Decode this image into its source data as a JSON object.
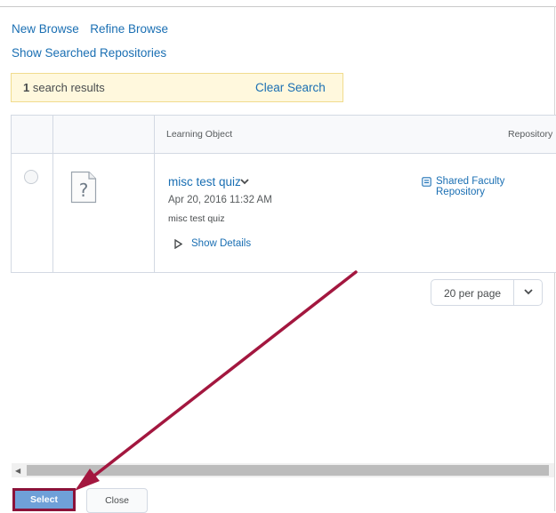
{
  "nav": {
    "new_browse": "New Browse",
    "refine_browse": "Refine Browse",
    "show_searched": "Show Searched Repositories"
  },
  "results": {
    "count": "1",
    "label": " search results",
    "clear_label": "Clear Search"
  },
  "table": {
    "headers": {
      "learning_object": "Learning Object",
      "repository": "Repository"
    },
    "rows": [
      {
        "title": "misc test quiz",
        "date": "Apr 20, 2016 11:32 AM",
        "description": "misc test quiz",
        "details_label": "Show Details",
        "repository": "Shared Faculty Repository"
      }
    ]
  },
  "pagination": {
    "per_page_label": "20 per page"
  },
  "buttons": {
    "select": "Select",
    "close": "Close"
  },
  "colors": {
    "link": "#1a6fb3",
    "annotation_arrow": "#a3173f",
    "select_button": "#6fa0d8"
  },
  "icons": [
    "unknown-file-icon",
    "chevron-down-icon",
    "triangle-right-icon",
    "repository-icon",
    "scroll-left-icon"
  ]
}
